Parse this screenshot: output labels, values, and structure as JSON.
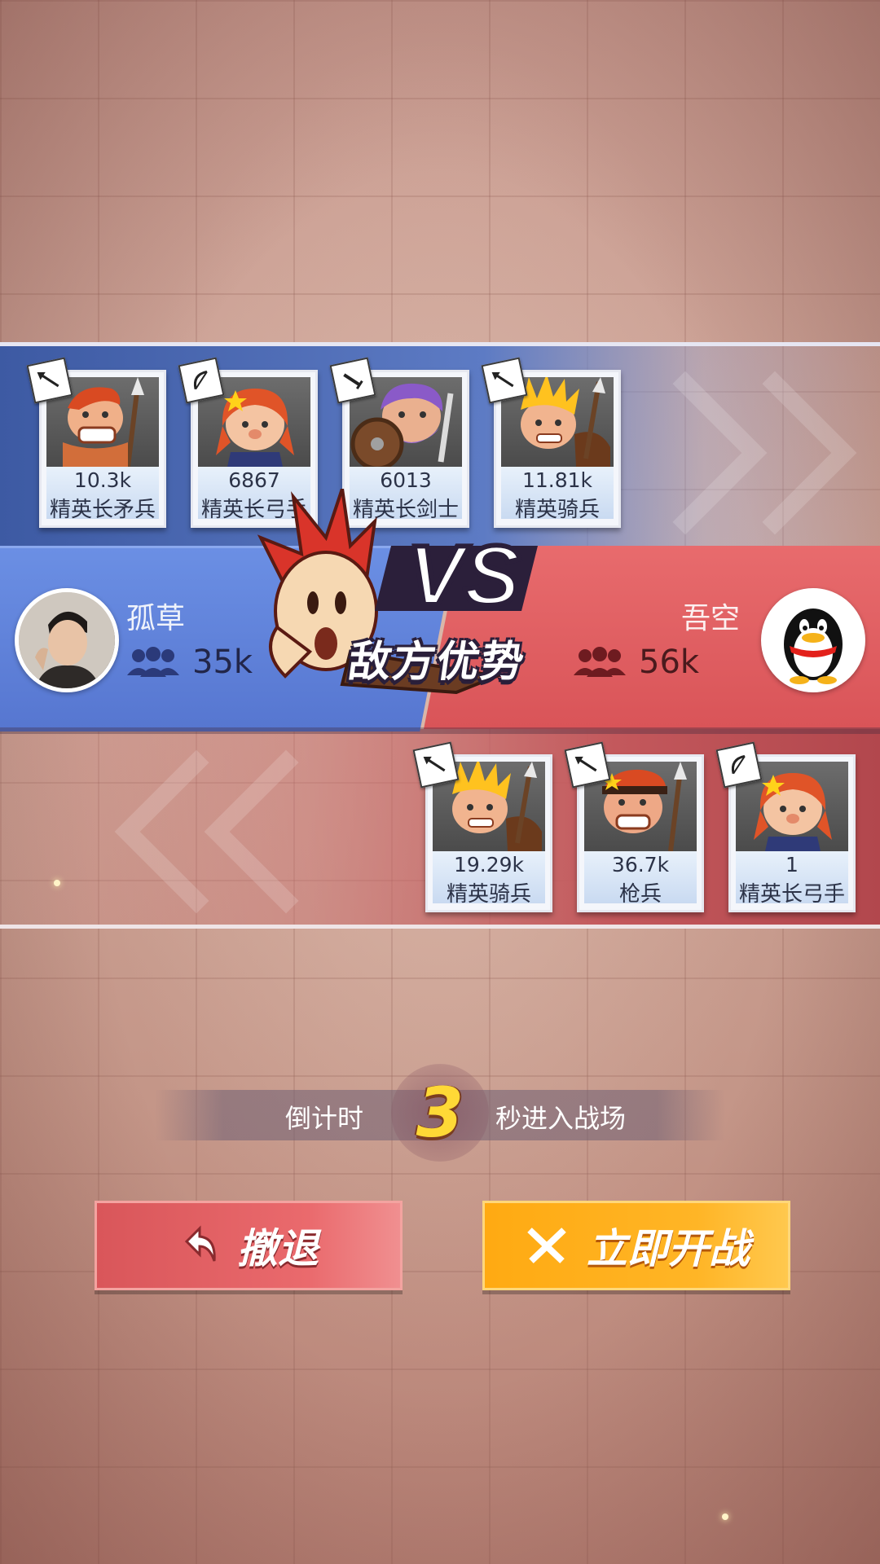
{
  "colors": {
    "ally_blue": "#5676d0",
    "enemy_red": "#d95458",
    "retreat_button": "#e6595d",
    "fight_button": "#ffaa12",
    "countdown_number": "#ffd936"
  },
  "ally_units": [
    {
      "value": "10.3k",
      "name": "精英长矛兵",
      "icon": "spear-icon"
    },
    {
      "value": "6867",
      "name": "精英长弓手",
      "icon": "bow-icon"
    },
    {
      "value": "6013",
      "name": "精英长剑士",
      "icon": "sword-icon"
    },
    {
      "value": "11.81k",
      "name": "精英骑兵",
      "icon": "spear-icon"
    }
  ],
  "enemy_units": [
    {
      "value": "19.29k",
      "name": "精英骑兵",
      "icon": "spear-icon"
    },
    {
      "value": "36.7k",
      "name": "枪兵",
      "icon": "spear-icon"
    },
    {
      "value": "1",
      "name": "精英长弓手",
      "icon": "bow-icon"
    }
  ],
  "ally_player": {
    "name": "孤草",
    "power": "35k"
  },
  "enemy_player": {
    "name": "吾空",
    "power": "56k",
    "avatar_icon": "penguin-icon"
  },
  "banner": {
    "vs_text": "VS",
    "advantage_text": "敌方优势"
  },
  "countdown": {
    "prefix": "倒计时",
    "seconds": "3",
    "suffix": "秒进入战场"
  },
  "buttons": {
    "retreat": "撤退",
    "fight": "立即开战"
  }
}
